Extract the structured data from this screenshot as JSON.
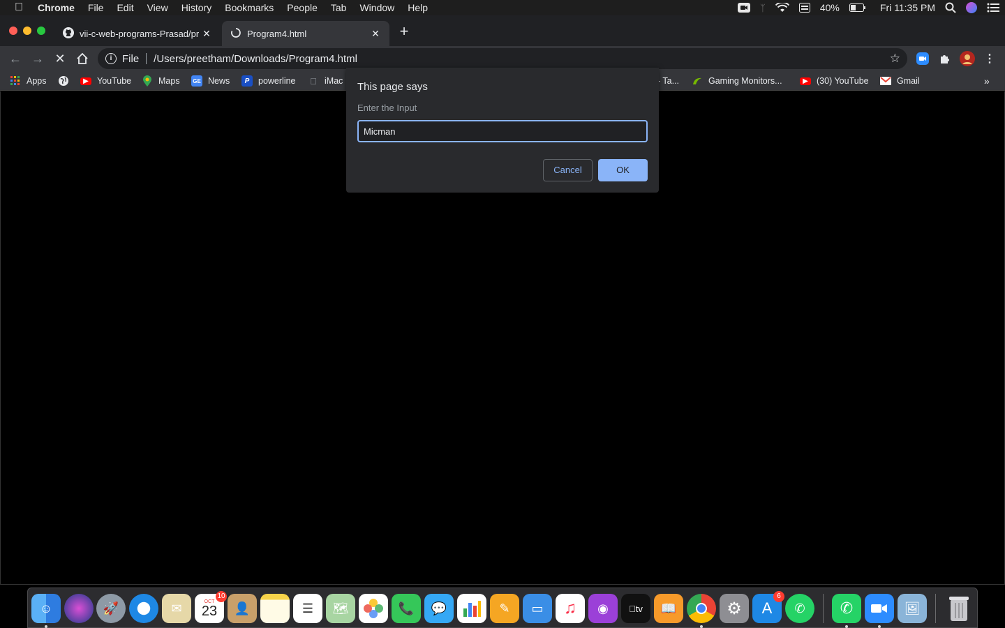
{
  "menubar": {
    "app": "Chrome",
    "items": [
      "File",
      "Edit",
      "View",
      "History",
      "Bookmarks",
      "People",
      "Tab",
      "Window",
      "Help"
    ],
    "battery": "40%",
    "clock": "Fri 11:35 PM"
  },
  "tabs": [
    {
      "title": "vii-c-web-programs-Prasad/pr",
      "icon": "github-icon"
    },
    {
      "title": "Program4.html",
      "icon": "loading-spinner-icon"
    }
  ],
  "omnibox": {
    "scheme": "File",
    "url": "/Users/preetham/Downloads/Program4.html"
  },
  "bookmarks": [
    {
      "label": "Apps",
      "icon": "apps-grid-icon"
    },
    {
      "label": "",
      "icon": "globe-icon"
    },
    {
      "label": "YouTube",
      "icon": "youtube-icon"
    },
    {
      "label": "Maps",
      "icon": "maps-icon"
    },
    {
      "label": "News",
      "icon": "news-icon"
    },
    {
      "label": "powerline",
      "icon": "powerline-icon"
    },
    {
      "label": "iMac",
      "icon": "apple-icon"
    },
    {
      "label": "- Ta...",
      "icon": ""
    },
    {
      "label": "Gaming Monitors...",
      "icon": "nvidia-icon"
    },
    {
      "label": "(30) YouTube",
      "icon": "youtube-icon"
    },
    {
      "label": "Gmail",
      "icon": "gmail-icon"
    }
  ],
  "dialog": {
    "title": "This page says",
    "message": "Enter the Input",
    "input_value": "Micman",
    "cancel_label": "Cancel",
    "ok_label": "OK"
  },
  "dock": {
    "calendar_month": "OCT",
    "calendar_day": "23",
    "calendar_badge": "10",
    "appstore_badge": "6"
  },
  "colors": {
    "accent": "#8ab4f8",
    "dialog_bg": "#292a2d",
    "toolbar_bg": "#35363a",
    "tabstrip_bg": "#202124"
  }
}
